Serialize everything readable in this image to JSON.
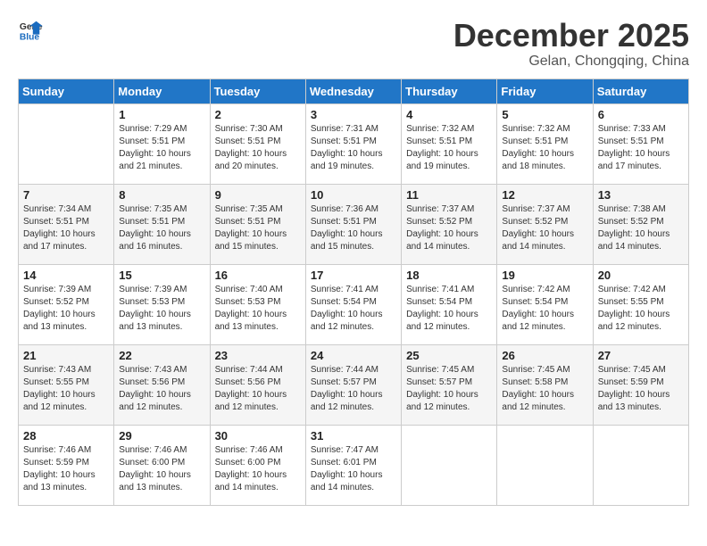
{
  "header": {
    "logo_line1": "General",
    "logo_line2": "Blue",
    "month": "December 2025",
    "location": "Gelan, Chongqing, China"
  },
  "weekdays": [
    "Sunday",
    "Monday",
    "Tuesday",
    "Wednesday",
    "Thursday",
    "Friday",
    "Saturday"
  ],
  "weeks": [
    [
      {
        "day": "",
        "info": ""
      },
      {
        "day": "1",
        "info": "Sunrise: 7:29 AM\nSunset: 5:51 PM\nDaylight: 10 hours\nand 21 minutes."
      },
      {
        "day": "2",
        "info": "Sunrise: 7:30 AM\nSunset: 5:51 PM\nDaylight: 10 hours\nand 20 minutes."
      },
      {
        "day": "3",
        "info": "Sunrise: 7:31 AM\nSunset: 5:51 PM\nDaylight: 10 hours\nand 19 minutes."
      },
      {
        "day": "4",
        "info": "Sunrise: 7:32 AM\nSunset: 5:51 PM\nDaylight: 10 hours\nand 19 minutes."
      },
      {
        "day": "5",
        "info": "Sunrise: 7:32 AM\nSunset: 5:51 PM\nDaylight: 10 hours\nand 18 minutes."
      },
      {
        "day": "6",
        "info": "Sunrise: 7:33 AM\nSunset: 5:51 PM\nDaylight: 10 hours\nand 17 minutes."
      }
    ],
    [
      {
        "day": "7",
        "info": "Sunrise: 7:34 AM\nSunset: 5:51 PM\nDaylight: 10 hours\nand 17 minutes."
      },
      {
        "day": "8",
        "info": "Sunrise: 7:35 AM\nSunset: 5:51 PM\nDaylight: 10 hours\nand 16 minutes."
      },
      {
        "day": "9",
        "info": "Sunrise: 7:35 AM\nSunset: 5:51 PM\nDaylight: 10 hours\nand 15 minutes."
      },
      {
        "day": "10",
        "info": "Sunrise: 7:36 AM\nSunset: 5:51 PM\nDaylight: 10 hours\nand 15 minutes."
      },
      {
        "day": "11",
        "info": "Sunrise: 7:37 AM\nSunset: 5:52 PM\nDaylight: 10 hours\nand 14 minutes."
      },
      {
        "day": "12",
        "info": "Sunrise: 7:37 AM\nSunset: 5:52 PM\nDaylight: 10 hours\nand 14 minutes."
      },
      {
        "day": "13",
        "info": "Sunrise: 7:38 AM\nSunset: 5:52 PM\nDaylight: 10 hours\nand 14 minutes."
      }
    ],
    [
      {
        "day": "14",
        "info": "Sunrise: 7:39 AM\nSunset: 5:52 PM\nDaylight: 10 hours\nand 13 minutes."
      },
      {
        "day": "15",
        "info": "Sunrise: 7:39 AM\nSunset: 5:53 PM\nDaylight: 10 hours\nand 13 minutes."
      },
      {
        "day": "16",
        "info": "Sunrise: 7:40 AM\nSunset: 5:53 PM\nDaylight: 10 hours\nand 13 minutes."
      },
      {
        "day": "17",
        "info": "Sunrise: 7:41 AM\nSunset: 5:54 PM\nDaylight: 10 hours\nand 12 minutes."
      },
      {
        "day": "18",
        "info": "Sunrise: 7:41 AM\nSunset: 5:54 PM\nDaylight: 10 hours\nand 12 minutes."
      },
      {
        "day": "19",
        "info": "Sunrise: 7:42 AM\nSunset: 5:54 PM\nDaylight: 10 hours\nand 12 minutes."
      },
      {
        "day": "20",
        "info": "Sunrise: 7:42 AM\nSunset: 5:55 PM\nDaylight: 10 hours\nand 12 minutes."
      }
    ],
    [
      {
        "day": "21",
        "info": "Sunrise: 7:43 AM\nSunset: 5:55 PM\nDaylight: 10 hours\nand 12 minutes."
      },
      {
        "day": "22",
        "info": "Sunrise: 7:43 AM\nSunset: 5:56 PM\nDaylight: 10 hours\nand 12 minutes."
      },
      {
        "day": "23",
        "info": "Sunrise: 7:44 AM\nSunset: 5:56 PM\nDaylight: 10 hours\nand 12 minutes."
      },
      {
        "day": "24",
        "info": "Sunrise: 7:44 AM\nSunset: 5:57 PM\nDaylight: 10 hours\nand 12 minutes."
      },
      {
        "day": "25",
        "info": "Sunrise: 7:45 AM\nSunset: 5:57 PM\nDaylight: 10 hours\nand 12 minutes."
      },
      {
        "day": "26",
        "info": "Sunrise: 7:45 AM\nSunset: 5:58 PM\nDaylight: 10 hours\nand 12 minutes."
      },
      {
        "day": "27",
        "info": "Sunrise: 7:45 AM\nSunset: 5:59 PM\nDaylight: 10 hours\nand 13 minutes."
      }
    ],
    [
      {
        "day": "28",
        "info": "Sunrise: 7:46 AM\nSunset: 5:59 PM\nDaylight: 10 hours\nand 13 minutes."
      },
      {
        "day": "29",
        "info": "Sunrise: 7:46 AM\nSunset: 6:00 PM\nDaylight: 10 hours\nand 13 minutes."
      },
      {
        "day": "30",
        "info": "Sunrise: 7:46 AM\nSunset: 6:00 PM\nDaylight: 10 hours\nand 14 minutes."
      },
      {
        "day": "31",
        "info": "Sunrise: 7:47 AM\nSunset: 6:01 PM\nDaylight: 10 hours\nand 14 minutes."
      },
      {
        "day": "",
        "info": ""
      },
      {
        "day": "",
        "info": ""
      },
      {
        "day": "",
        "info": ""
      }
    ]
  ]
}
